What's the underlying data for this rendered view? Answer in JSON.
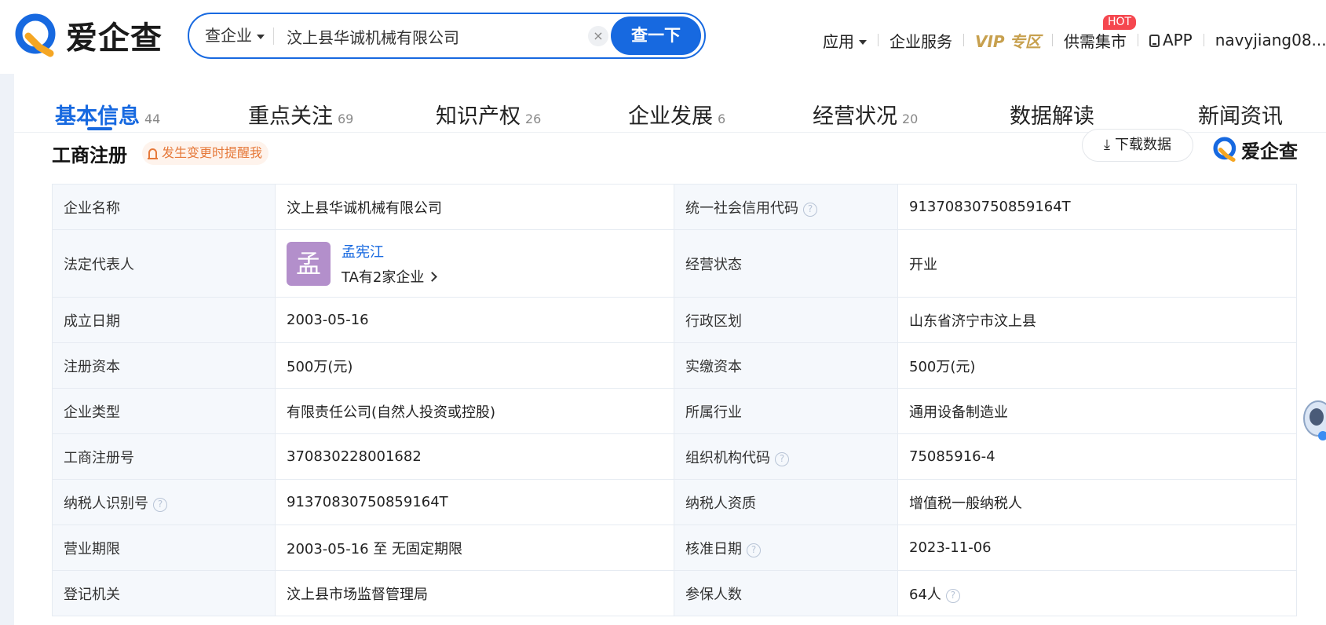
{
  "brand": {
    "logo_text": "爱企查",
    "accent": "#1769e0",
    "logo_orange": "#f5a623"
  },
  "search": {
    "type_label": "查企业",
    "query": "汶上县华诚机械有限公司",
    "clear_symbol": "×",
    "button_label": "查一下"
  },
  "nav": {
    "apps": "应用",
    "enterprise_service": "企业服务",
    "vip_label": "VIP",
    "vip_zone": "专区",
    "supply_market": "供需集市",
    "hot_badge": "HOT",
    "app": "APP",
    "user": "navyjiang08..."
  },
  "tabs": [
    {
      "label": "基本信息",
      "count": "44",
      "active": true
    },
    {
      "label": "重点关注",
      "count": "69"
    },
    {
      "label": "知识产权",
      "count": "26"
    },
    {
      "label": "企业发展",
      "count": "6"
    },
    {
      "label": "经营状况",
      "count": "20"
    },
    {
      "label": "数据解读",
      "count": ""
    },
    {
      "label": "新闻资讯",
      "count": ""
    }
  ],
  "section": {
    "title": "工商注册",
    "remind": "发生变更时提醒我",
    "download": "下载数据",
    "watermark": "爱企查"
  },
  "table": {
    "rows": [
      {
        "l1": "企业名称",
        "v1": "汶上县华诚机械有限公司",
        "l2": "统一社会信用代码",
        "v2": "91370830750859164T"
      },
      {
        "l1": "法定代表人",
        "avatar_char": "孟",
        "person_name": "孟宪江",
        "person_sub": "TA有2家企业",
        "l2": "经营状态",
        "v2": "开业"
      },
      {
        "l1": "成立日期",
        "v1": "2003-05-16",
        "l2": "行政区划",
        "v2": "山东省济宁市汶上县"
      },
      {
        "l1": "注册资本",
        "v1": "500万(元)",
        "l2": "实缴资本",
        "v2": "500万(元)"
      },
      {
        "l1": "企业类型",
        "v1": "有限责任公司(自然人投资或控股)",
        "l2": "所属行业",
        "v2": "通用设备制造业"
      },
      {
        "l1": "工商注册号",
        "v1": "370830228001682",
        "l2": "组织机构代码",
        "v2": "75085916-4"
      },
      {
        "l1": "纳税人识别号",
        "v1": "91370830750859164T",
        "l2": "纳税人资质",
        "v2": "增值税一般纳税人"
      },
      {
        "l1": "营业期限",
        "v1": "2003-05-16 至 无固定期限",
        "l2": "核准日期",
        "v2": "2023-11-06"
      },
      {
        "l1": "登记机关",
        "v1": "汶上县市场监督管理局",
        "l2": "参保人数",
        "v2": "64人"
      }
    ]
  },
  "help_symbol": "?"
}
